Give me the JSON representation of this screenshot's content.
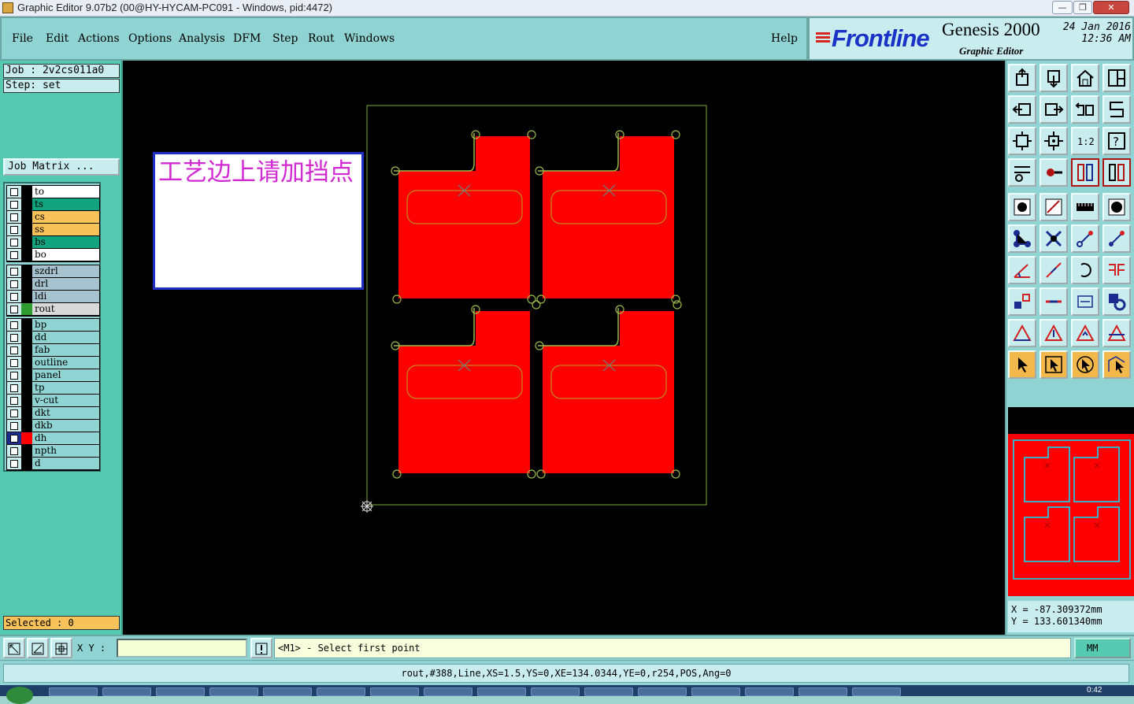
{
  "window": {
    "title": "Graphic Editor 9.07b2 (00@HY-HYCAM-PC091 - Windows, pid:4472)",
    "minimize": "—",
    "maximize": "❐",
    "close": "✕"
  },
  "menu": {
    "items": [
      "File",
      "Edit",
      "Actions",
      "Options",
      "Analysis",
      "DFM",
      "Step",
      "Rout",
      "Windows"
    ],
    "help": "Help"
  },
  "logo": {
    "brand": "Frontline",
    "product": "Genesis 2000",
    "subtitle": "Graphic Editor",
    "date": "24 Jan 2016",
    "time": "12:36 AM"
  },
  "job": {
    "job_line": "Job : 2v2cs011a0",
    "step_line": "Step: set",
    "matrix_button": "Job Matrix ..."
  },
  "layers": {
    "group1": [
      {
        "name": "to",
        "color": "#ffffff"
      },
      {
        "name": "ts",
        "color": "#10a37d"
      },
      {
        "name": "cs",
        "color": "#f7c25a"
      },
      {
        "name": "ss",
        "color": "#f7c25a"
      },
      {
        "name": "bs",
        "color": "#10a37d"
      },
      {
        "name": "bo",
        "color": "#ffffff"
      }
    ],
    "group2": [
      {
        "name": "szdrl",
        "color": "#a6c3cf"
      },
      {
        "name": "drl",
        "color": "#a6c3cf"
      },
      {
        "name": "ldi",
        "color": "#a6c3cf"
      },
      {
        "name": "rout",
        "color": "#d9d9d9"
      }
    ],
    "group3": [
      {
        "name": "bp",
        "color": "#8fd3d3"
      },
      {
        "name": "dd",
        "color": "#8fd3d3"
      },
      {
        "name": "fab",
        "color": "#8fd3d3"
      },
      {
        "name": "outline",
        "color": "#8fd3d3"
      },
      {
        "name": "panel",
        "color": "#8fd3d3"
      },
      {
        "name": "tp",
        "color": "#8fd3d3"
      },
      {
        "name": "v-cut",
        "color": "#8fd3d3"
      },
      {
        "name": "dkt",
        "color": "#8fd3d3"
      },
      {
        "name": "dkb",
        "color": "#8fd3d3"
      },
      {
        "name": "dh",
        "color": "#8fd3d3"
      },
      {
        "name": "npth",
        "color": "#8fd3d3"
      },
      {
        "name": "d",
        "color": "#8fd3d3"
      }
    ]
  },
  "selected": "Selected : 0",
  "note": "工艺边上请加挡点",
  "coords": {
    "x": "X  =  -87.309372mm",
    "y": "Y  =  133.601340mm"
  },
  "command": {
    "xy_label": "X Y :",
    "xy_value": "",
    "prompt": "<M1> - Select first point",
    "units": "MM"
  },
  "status": "rout,#388,Line,XS=1.5,YS=0,XE=134.0344,YE=0,r254,POS,Ang=0",
  "clock": "0:42"
}
